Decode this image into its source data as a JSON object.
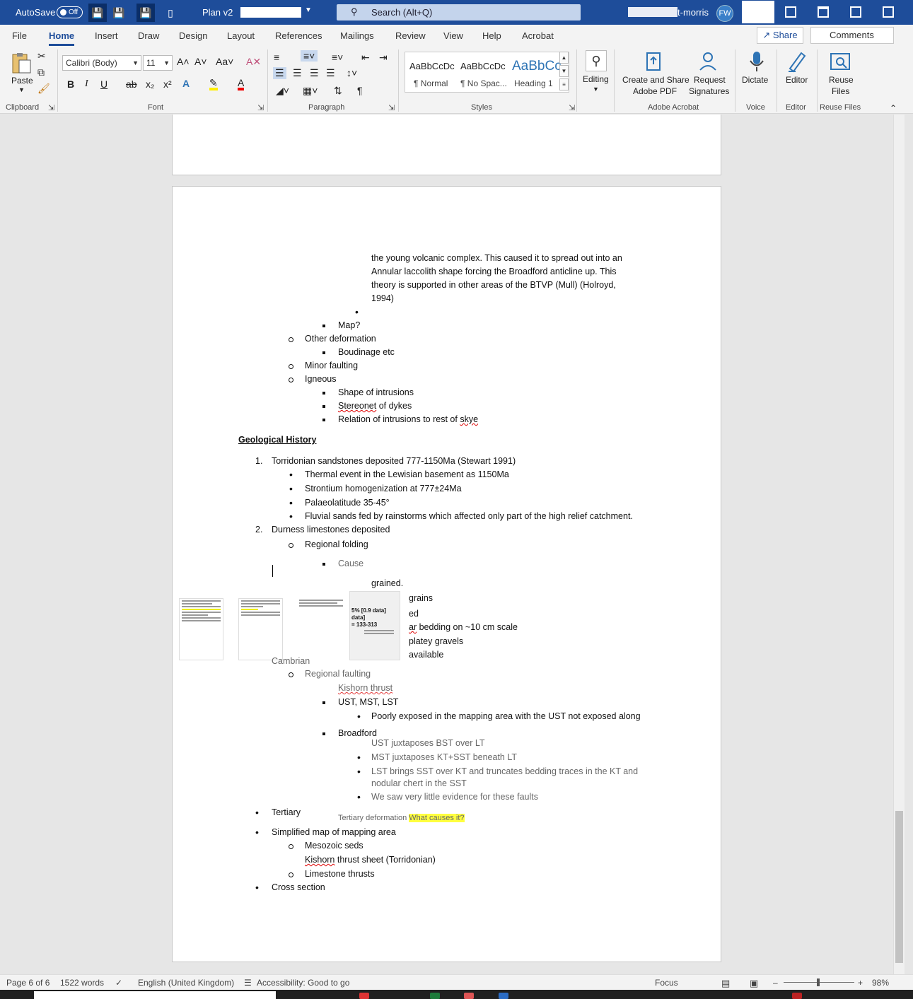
{
  "titlebar": {
    "autosave_label": "AutoSave",
    "autosave_state": "Off",
    "doc_title": "Plan v2",
    "search_placeholder": "Search (Alt+Q)",
    "user_name": "t-morris",
    "user_initials": "FW"
  },
  "menu": {
    "tabs": [
      "File",
      "Home",
      "Insert",
      "Draw",
      "Design",
      "Layout",
      "References",
      "Mailings",
      "Review",
      "View",
      "Help",
      "Acrobat"
    ],
    "active_tab": "Home",
    "share_label": "Share",
    "comments_label": "Comments"
  },
  "ribbon": {
    "paste_label": "Paste",
    "font_name": "Calibri (Body)",
    "font_size": "11",
    "groups": {
      "clipboard": "Clipboard",
      "font": "Font",
      "paragraph": "Paragraph",
      "styles": "Styles",
      "adobe": "Adobe Acrobat",
      "voice": "Voice",
      "editor": "Editor",
      "reuse": "Reuse Files"
    },
    "styles": [
      {
        "preview": "AaBbCcDc",
        "name": "¶ Normal"
      },
      {
        "preview": "AaBbCcDc",
        "name": "¶ No Spac..."
      },
      {
        "preview": "AaBbCc",
        "name": "Heading 1"
      }
    ],
    "editing_label": "Editing",
    "create_share_label_1": "Create and Share",
    "create_share_label_2": "Adobe PDF",
    "request_sig_label_1": "Request",
    "request_sig_label_2": "Signatures",
    "dictate_label": "Dictate",
    "editor_label": "Editor",
    "reuse_label_1": "Reuse",
    "reuse_label_2": "Files"
  },
  "document": {
    "para1_l1": "the young volcanic complex. This caused it to spread out into an",
    "para1_l2": "Annular laccolith shape forcing the Broadford anticline up. This",
    "para1_l3": "theory is supported in other areas of the BTVP (Mull) (Holroyd,",
    "para1_l4": "1994)",
    "map_q": "Map?",
    "other_deformation": "Other deformation",
    "boudinage": "Boudinage etc",
    "minor_faulting": "Minor faulting",
    "igneous": "Igneous",
    "shape_intrusions": "Shape of intrusions",
    "stereonet_word": "Stereonet",
    "stereonet_rest": " of dykes",
    "relation_text": "Relation of intrusions to rest of ",
    "relation_skye": "skye",
    "geo_history": "Geological History",
    "h1_num": "1.",
    "h1": "Torridonian sandstones deposited 777-1150Ma (Stewart 1991)",
    "h1_b1": "Thermal event in the Lewisian basement as 1150Ma",
    "h1_b2": "Strontium homogenization at 777±24Ma",
    "h1_b3": "Palaeolatitude 35-45°",
    "h1_b4": "Fluvial sands fed by rainstorms which affected only part of the high relief catchment.",
    "h2_num": "2.",
    "h2": "Durness limestones deposited",
    "regional_folding": "Regional folding",
    "cause": "Cause",
    "grained": "grained.",
    "grains_frag": "grains",
    "ed_frag": "ed",
    "bedding_frag_pre": "ar",
    "bedding_frag": " bedding on ~10 cm scale",
    "platey_frag": "platey gravels",
    "available_frag": "available",
    "thumb_stat_1": "5%  [0.9 data]",
    "thumb_stat_2": "data]",
    "thumb_stat_3": "= 133-313",
    "cambrian": "Cambrian",
    "regional_faulting": "Regional faulting",
    "kishorn_thrust": "Kishorn thrust",
    "ust_mst_lst": "UST, MST, LST",
    "poorly_exposed": "Poorly exposed in the mapping area with the UST not exposed along",
    "broadford": "Broadford",
    "ust_juxt": "UST juxtaposes BST over LT",
    "mst_juxt": "MST juxtaposes KT+SST beneath LT",
    "lst_brings_1": "LST brings SST over KT and truncates bedding traces in the KT and",
    "lst_brings_2": "nodular chert in the SST",
    "little_evidence": "We saw very little evidence for these faults",
    "tertiary": "Tertiary",
    "tertiary_deform": "Tertiary deformation",
    "what_causes": "What causes it?",
    "simplified_map": "Simplified map of mapping area",
    "mesozoic": "Mesozoic seds",
    "kishorn_sheet_word": "Kishorn",
    "kishorn_sheet_rest": " thrust sheet (Torridonian)",
    "limestone_thrusts": "Limestone thrusts",
    "cross_section": "Cross section"
  },
  "status": {
    "page": "Page 6 of 6",
    "words": "1522 words",
    "language": "English (United Kingdom)",
    "accessibility": "Accessibility: Good to go",
    "focus": "Focus",
    "zoom": "98%"
  },
  "colors": {
    "titlebar_bg": "#1e4d9a",
    "accent": "#1e4d9a",
    "highlight": "#ffff00",
    "spell_error": "#dd0000"
  }
}
